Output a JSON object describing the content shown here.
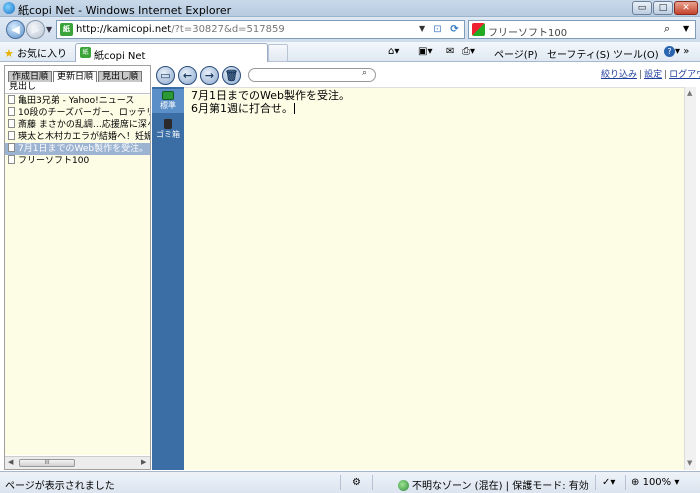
{
  "window": {
    "title": "紙copi Net - Windows Internet Explorer",
    "min_glyph": "▭",
    "max_glyph": "□",
    "close_glyph": "✕"
  },
  "address": {
    "url_main": "http://kamicopi.net",
    "url_rest": "/?t=30827&d=517859",
    "site_icon_text": "紙"
  },
  "search": {
    "provider_text": "フリーソフト100"
  },
  "favorites": {
    "label": "お気に入り",
    "tab_title": "紙copi Net"
  },
  "command_bar": {
    "page": "ページ(P)",
    "safety": "セーフティ(S)",
    "tools": "ツール(O)",
    "help": "?"
  },
  "left_panel": {
    "tabs": [
      "作成日順",
      "更新日順",
      "見出し順"
    ],
    "active_tab": 1,
    "header": "見出し",
    "items": [
      "亀田3兄弟 - Yahoo!ニュース",
      "10段のチーズバーガー、ロッテリアから",
      "斎藤 まさかの乱調…応援席に深々",
      "瑛太と木村カエラが結婚へ！妊娠5ヶ月",
      "7月1日までのWeb製作を受注。",
      "フリーソフト100"
    ],
    "selected_index": 4,
    "scroll_thumb_text": "III"
  },
  "sidebar": {
    "folders": [
      {
        "label": "標準",
        "icon": "folder-icon"
      },
      {
        "label": "ゴミ箱",
        "icon": "trash-icon"
      }
    ]
  },
  "toolbar": {
    "buttons": [
      "new-document-icon",
      "back-arrow-icon",
      "forward-arrow-icon",
      "trash-icon"
    ],
    "links": [
      "絞り込み",
      "設定",
      "ログアウト"
    ]
  },
  "editor": {
    "lines": [
      "7月1日までのWeb製作を受注。",
      "6月第1週に打合せ。"
    ]
  },
  "status": {
    "left": "ページが表示されました",
    "zone": "不明なゾーン (混在) | 保護モード: 有効",
    "zoom": "100%"
  }
}
